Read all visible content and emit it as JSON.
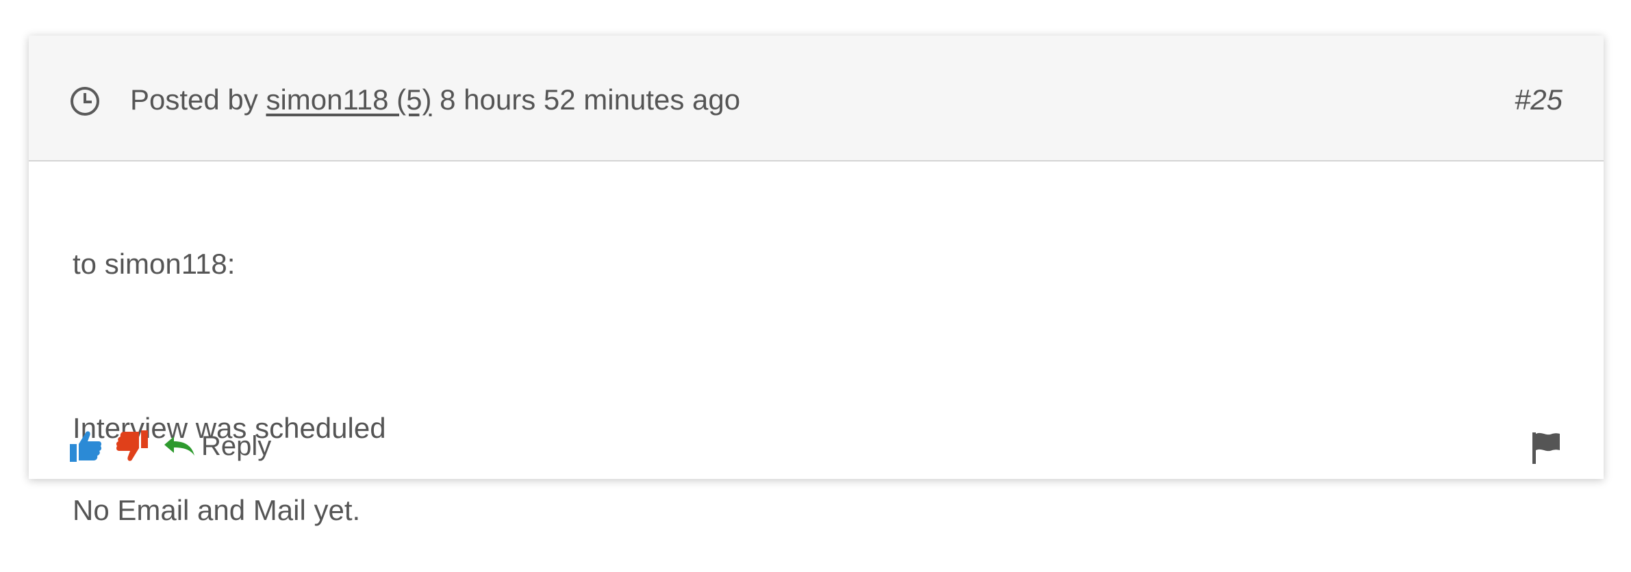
{
  "header": {
    "posted_by_prefix": "Posted by",
    "author": "simon118 (5)",
    "time_ago": "8 hours 52 minutes ago",
    "post_number": "#25"
  },
  "body": {
    "line1": "to simon118:",
    "line2": "Interview was scheduled",
    "line3": "No Email and Mail yet."
  },
  "actions": {
    "reply_label": "Reply"
  },
  "icons": {
    "clock": "clock-icon",
    "thumbs_up": "thumbs-up-icon",
    "thumbs_down": "thumbs-down-icon",
    "reply": "reply-arrow-icon",
    "flag": "flag-icon"
  },
  "colors": {
    "thumbs_up": "#2b8ad6",
    "thumbs_down": "#e0401a",
    "reply": "#2e9a2e",
    "flag": "#555555",
    "text": "#555555",
    "header_bg": "#f6f6f6"
  }
}
